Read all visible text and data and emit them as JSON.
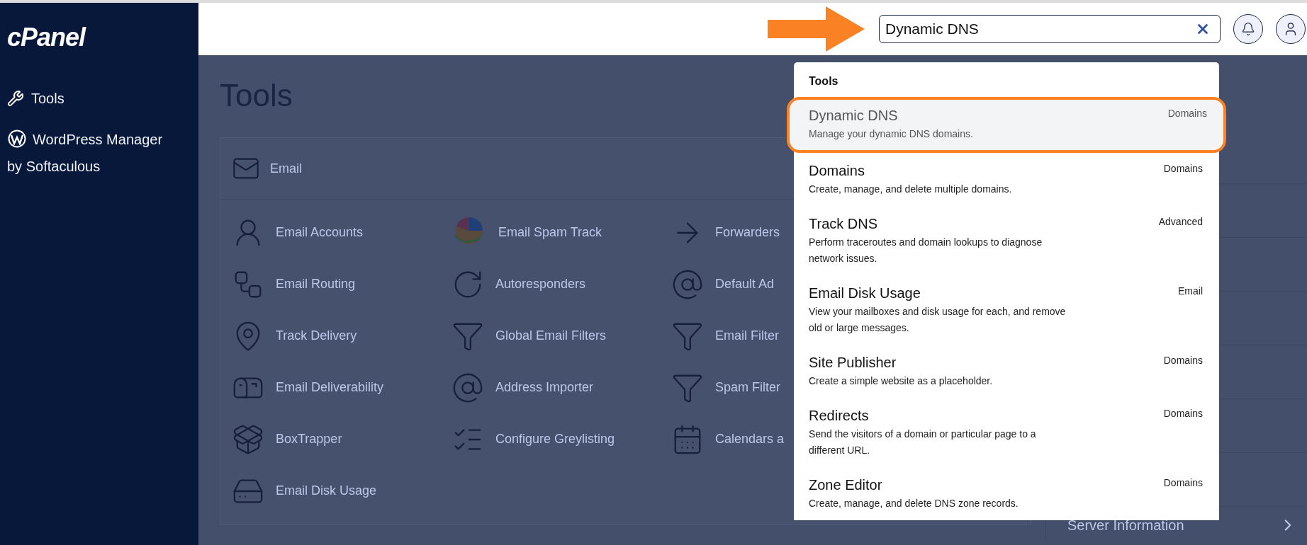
{
  "sidebar": {
    "logo": "cPanel",
    "items": [
      {
        "label": "Tools"
      },
      {
        "label": "WordPress Manager by Softaculous"
      }
    ]
  },
  "header": {
    "search": {
      "value": "Dynamic DNS"
    }
  },
  "main": {
    "title": "Tools",
    "section": {
      "title": "Email",
      "tools": [
        {
          "label": "Email Accounts"
        },
        {
          "label": "Email Spam Track"
        },
        {
          "label": "Forwarders"
        },
        {
          "label": "Email Routing"
        },
        {
          "label": "Autoresponders"
        },
        {
          "label": "Default Ad"
        },
        {
          "label": "Track Delivery"
        },
        {
          "label": "Global Email Filters"
        },
        {
          "label": "Email Filter"
        },
        {
          "label": "Email Deliverability"
        },
        {
          "label": "Address Importer"
        },
        {
          "label": "Spam Filter"
        },
        {
          "label": "BoxTrapper"
        },
        {
          "label": "Configure Greylisting"
        },
        {
          "label": "Calendars a"
        },
        {
          "label": "Email Disk Usage"
        }
      ]
    }
  },
  "right_panel": {
    "items": [
      {
        "label": "Server Information"
      }
    ]
  },
  "dropdown": {
    "heading": "Tools",
    "results": [
      {
        "title": "Dynamic DNS",
        "description": "Manage your dynamic DNS domains.",
        "category": "Domains",
        "selected": true
      },
      {
        "title": "Domains",
        "description": "Create, manage, and delete multiple domains.",
        "category": "Domains",
        "selected": false
      },
      {
        "title": "Track DNS",
        "description": "Perform traceroutes and domain lookups to diagnose network issues.",
        "category": "Advanced",
        "selected": false
      },
      {
        "title": "Email Disk Usage",
        "description": "View your mailboxes and disk usage for each, and remove old or large messages.",
        "category": "Email",
        "selected": false
      },
      {
        "title": "Site Publisher",
        "description": "Create a simple website as a placeholder.",
        "category": "Domains",
        "selected": false
      },
      {
        "title": "Redirects",
        "description": "Send the visitors of a domain or particular page to a different URL.",
        "category": "Domains",
        "selected": false
      },
      {
        "title": "Zone Editor",
        "description": "Create, manage, and delete DNS zone records.",
        "category": "Domains",
        "selected": false
      }
    ]
  }
}
